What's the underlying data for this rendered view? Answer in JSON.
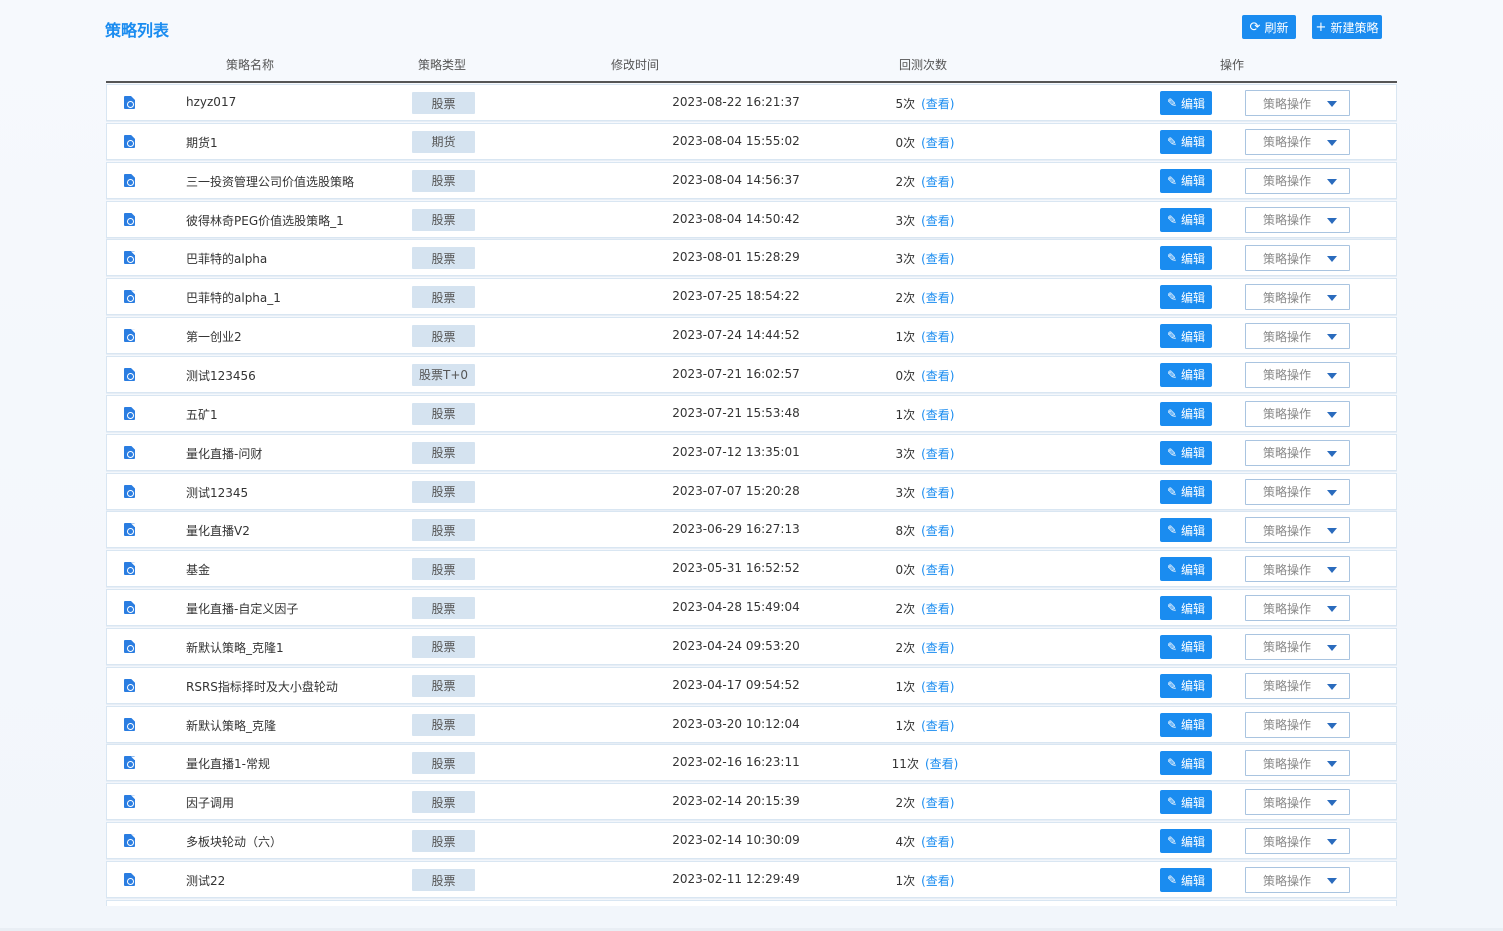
{
  "page_title": "策略列表",
  "toolbar": {
    "refresh_label": "刷新",
    "new_label": "新建策略"
  },
  "columns": {
    "name": "策略名称",
    "type": "策略类型",
    "modified": "修改时间",
    "backtests": "回测次数",
    "actions": "操作"
  },
  "row_labels": {
    "view": "(查看)",
    "edit": "编辑",
    "ops": "策略操作"
  },
  "rows": [
    {
      "name": "hzyz017",
      "type": "股票",
      "time": "2023-08-22 16:21:37",
      "count": "5次"
    },
    {
      "name": "期货1",
      "type": "期货",
      "time": "2023-08-04 15:55:02",
      "count": "0次"
    },
    {
      "name": "三一投资管理公司价值选股策略",
      "type": "股票",
      "time": "2023-08-04 14:56:37",
      "count": "2次"
    },
    {
      "name": "彼得林奇PEG价值选股策略_1",
      "type": "股票",
      "time": "2023-08-04 14:50:42",
      "count": "3次"
    },
    {
      "name": "巴菲特的alpha",
      "type": "股票",
      "time": "2023-08-01 15:28:29",
      "count": "3次"
    },
    {
      "name": "巴菲特的alpha_1",
      "type": "股票",
      "time": "2023-07-25 18:54:22",
      "count": "2次"
    },
    {
      "name": "第一创业2",
      "type": "股票",
      "time": "2023-07-24 14:44:52",
      "count": "1次"
    },
    {
      "name": "测试123456",
      "type": "股票T+0",
      "time": "2023-07-21 16:02:57",
      "count": "0次"
    },
    {
      "name": "五矿1",
      "type": "股票",
      "time": "2023-07-21 15:53:48",
      "count": "1次"
    },
    {
      "name": "量化直播-问财",
      "type": "股票",
      "time": "2023-07-12 13:35:01",
      "count": "3次"
    },
    {
      "name": "测试12345",
      "type": "股票",
      "time": "2023-07-07 15:20:28",
      "count": "3次"
    },
    {
      "name": "量化直播V2",
      "type": "股票",
      "time": "2023-06-29 16:27:13",
      "count": "8次"
    },
    {
      "name": "基金",
      "type": "股票",
      "time": "2023-05-31 16:52:52",
      "count": "0次"
    },
    {
      "name": "量化直播-自定义因子",
      "type": "股票",
      "time": "2023-04-28 15:49:04",
      "count": "2次"
    },
    {
      "name": "新默认策略_克隆1",
      "type": "股票",
      "time": "2023-04-24 09:53:20",
      "count": "2次"
    },
    {
      "name": "RSRS指标择时及大小盘轮动",
      "type": "股票",
      "time": "2023-04-17 09:54:52",
      "count": "1次"
    },
    {
      "name": "新默认策略_克隆",
      "type": "股票",
      "time": "2023-03-20 10:12:04",
      "count": "1次"
    },
    {
      "name": "量化直播1-常规",
      "type": "股票",
      "time": "2023-02-16 16:23:11",
      "count": "11次"
    },
    {
      "name": "因子调用",
      "type": "股票",
      "time": "2023-02-14 20:15:39",
      "count": "2次"
    },
    {
      "name": "多板块轮动（六）",
      "type": "股票",
      "time": "2023-02-14 10:30:09",
      "count": "4次"
    },
    {
      "name": "测试22",
      "type": "股票",
      "time": "2023-02-11 12:29:49",
      "count": "1次"
    },
    {
      "name": "",
      "type": "",
      "time": "",
      "count": ""
    }
  ]
}
